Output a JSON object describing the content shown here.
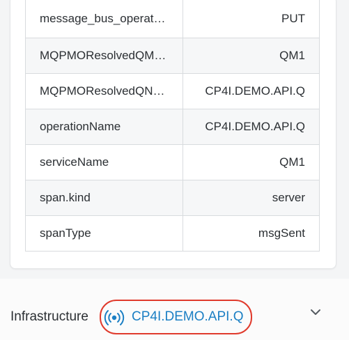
{
  "tags": {
    "rows": [
      {
        "key": "message_bus_operat…",
        "value": "PUT"
      },
      {
        "key": "MQPMOResolvedQM…",
        "value": "QM1"
      },
      {
        "key": "MQPMOResolvedQN…",
        "value": "CP4I.DEMO.API.Q"
      },
      {
        "key": "operationName",
        "value": "CP4I.DEMO.API.Q"
      },
      {
        "key": "serviceName",
        "value": "QM1"
      },
      {
        "key": "span.kind",
        "value": "server"
      },
      {
        "key": "spanType",
        "value": "msgSent"
      }
    ]
  },
  "infrastructure": {
    "label": "Infrastructure",
    "entity_name": "CP4I.DEMO.API.Q",
    "entity_icon": "queue-broadcast-icon",
    "expand_icon": "chevron-down-icon",
    "link_color": "#1b7fc4",
    "highlight_color": "#e03a2c"
  }
}
